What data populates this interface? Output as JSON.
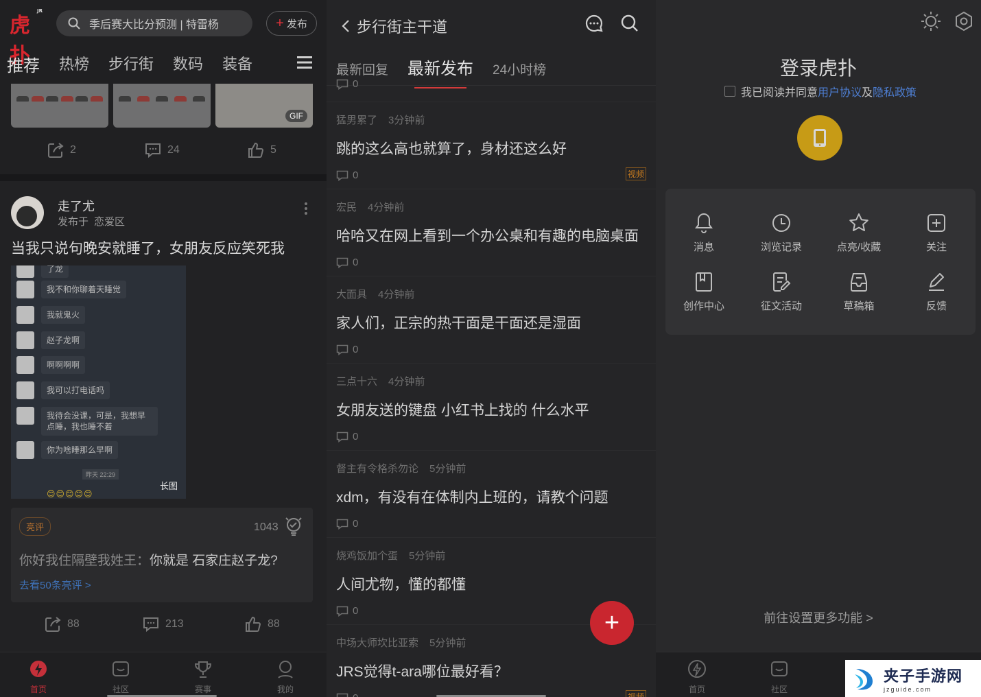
{
  "home": {
    "logo_text": "虎扑",
    "logo_badge": "JR",
    "search_placeholder": "季后赛大比分预测 | 特雷杨",
    "publish_label": "发布",
    "tabs": [
      "推荐",
      "热榜",
      "步行街",
      "数码",
      "装备"
    ],
    "gif_badge": "GIF",
    "prev_post_actions": {
      "share": "2",
      "comment": "24",
      "like": "5"
    },
    "post": {
      "author": "走了尤",
      "posted_in_prefix": "发布于",
      "posted_in": "恋爱区",
      "title": "当我只说句晚安就睡了，女朋友反应笑死我",
      "chat_top_fragment": "了龙",
      "chat_lines": [
        "我不和你聊着天睡觉",
        "我就鬼火",
        "赵子龙啊",
        "啊啊啊啊",
        "我可以打电话吗",
        "我待会没课，可是，我想早点睡，我也睡不着",
        "你为啥睡那么早啊"
      ],
      "chat_time": "昨天 22:29",
      "chat_emojis": "😊😊😊😊😊",
      "long_image_tag": "长图",
      "hot_badge": "亮评",
      "hot_count": "1043",
      "hot_user": "你好我住隔壁我姓王：",
      "hot_text": "你就是 石家庄赵子龙?",
      "hot_link": "去看50条亮评 >",
      "actions": {
        "share": "88",
        "comment": "213",
        "like": "88"
      }
    }
  },
  "tabbar": {
    "items": [
      "首页",
      "社区",
      "赛事",
      "我的"
    ]
  },
  "street": {
    "back_title": "步行街主干道",
    "tabs": [
      "最新回复",
      "最新发布",
      "24小时榜"
    ],
    "top_partial_count": "0",
    "threads": [
      {
        "user": "猛男累了",
        "time": "3分钟前",
        "title": "跳的这么高也就算了，身材还这么好",
        "comments": "0",
        "tag": "视频"
      },
      {
        "user": "宏民",
        "time": "4分钟前",
        "title": "哈哈又在网上看到一个办公桌和有趣的电脑桌面",
        "comments": "0",
        "tag": ""
      },
      {
        "user": "大面具",
        "time": "4分钟前",
        "title": "家人们，正宗的热干面是干面还是湿面",
        "comments": "0",
        "tag": ""
      },
      {
        "user": "三点十六",
        "time": "4分钟前",
        "title": "女朋友送的键盘 小红书上找的 什么水平",
        "comments": "0",
        "tag": ""
      },
      {
        "user": "督主有令格杀勿论",
        "time": "5分钟前",
        "title": "xdm，有没有在体制内上班的，请教个问题",
        "comments": "0",
        "tag": ""
      },
      {
        "user": "烧鸡饭加个蛋",
        "time": "5分钟前",
        "title": "人间尤物，懂的都懂",
        "comments": "0",
        "tag": ""
      },
      {
        "user": "中场大师坎比亚索",
        "time": "5分钟前",
        "title": "JRS觉得t-ara哪位最好看？",
        "comments": "0",
        "tag": "视频"
      }
    ],
    "fab": "+"
  },
  "me": {
    "login_title": "登录虎扑",
    "agree_prefix": "我已阅读并同意",
    "agree_link1": "用户协议",
    "agree_mid": "及",
    "agree_link2": "隐私政策",
    "grid": [
      "消息",
      "浏览记录",
      "点亮/收藏",
      "关注",
      "创作中心",
      "征文活动",
      "草稿箱",
      "反馈"
    ],
    "settings_link": "前往设置更多功能 >"
  },
  "watermark": {
    "title": "夹子手游网",
    "url": "jzguide.com"
  },
  "colors": {
    "accent_red": "#c9262f",
    "link_blue": "#4d7dd0",
    "gold": "#c79b16",
    "video_tag": "#c77b1f"
  }
}
